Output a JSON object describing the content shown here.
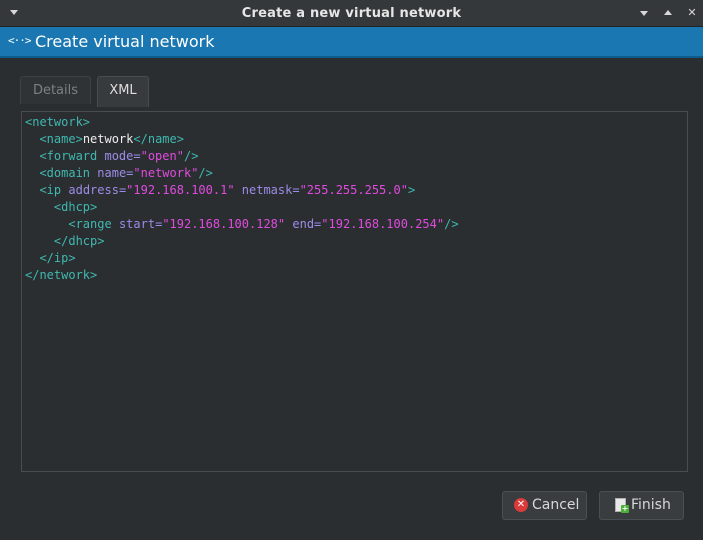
{
  "window": {
    "title": "Create a new virtual network"
  },
  "banner": {
    "icon": "<··>",
    "title": "Create virtual network"
  },
  "tabs": [
    {
      "label": "Details",
      "active": false
    },
    {
      "label": "XML",
      "active": true
    }
  ],
  "xml": {
    "l1_open": "<network>",
    "l2_open": "<name>",
    "l2_text": "network",
    "l2_close": "</name>",
    "l3_tag": "<forward",
    "l3_attr": "mode=",
    "l3_val": "\"open\"",
    "l3_end": "/>",
    "l4_tag": "<domain",
    "l4_attr": "name=",
    "l4_val": "\"network\"",
    "l4_end": "/>",
    "l5_tag": "<ip",
    "l5_attr1": "address=",
    "l5_val1": "\"192.168.100.1\"",
    "l5_attr2": "netmask=",
    "l5_val2": "\"255.255.255.0\"",
    "l5_end": ">",
    "l6_open": "<dhcp>",
    "l7_tag": "<range",
    "l7_attr1": "start=",
    "l7_val1": "\"192.168.100.128\"",
    "l7_attr2": "end=",
    "l7_val2": "\"192.168.100.254\"",
    "l7_end": "/>",
    "l8_close": "</dhcp>",
    "l9_close": "</ip>",
    "l10_close": "</network>"
  },
  "buttons": {
    "cancel_label": "Cancel",
    "finish_label": "Finish"
  },
  "icons": {
    "window_menu": "chevron-down-icon",
    "minimize": "minimize-icon",
    "maximize": "maximize-icon",
    "close": "close-icon",
    "banner": "network-icon",
    "cancel": "cancel-icon",
    "finish": "finish-icon"
  },
  "colors": {
    "banner": "#1a77b1",
    "xml_tag": "#3fb8b0",
    "xml_attr": "#9a8ce8",
    "xml_value": "#e04bdf"
  }
}
